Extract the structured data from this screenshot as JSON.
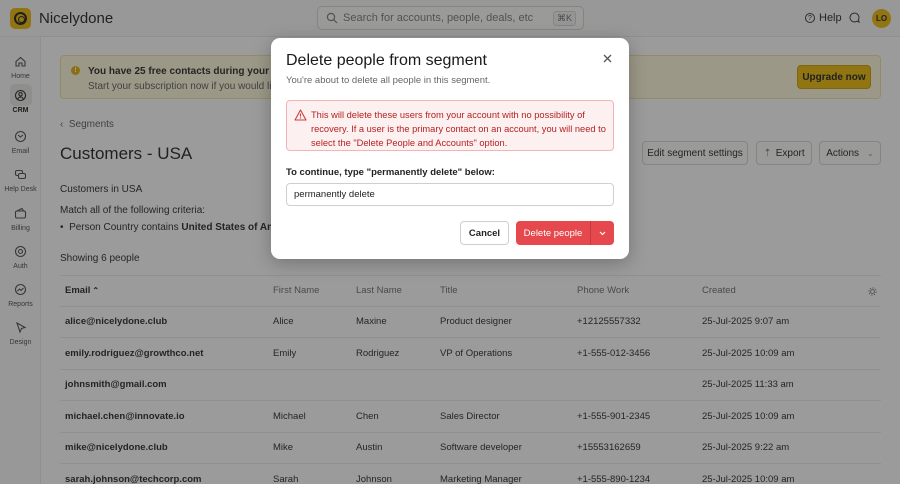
{
  "app": {
    "name": "Nicelydone",
    "user_initials": "LO"
  },
  "search": {
    "placeholder": "Search for accounts, people, deals, etc",
    "shortcut": "⌘K"
  },
  "topbar": {
    "help_label": "Help"
  },
  "sidebar": {
    "items": [
      {
        "label": "Home",
        "icon": "home-icon"
      },
      {
        "label": "CRM",
        "icon": "crm-icon",
        "active": true
      },
      {
        "label": "Email",
        "icon": "email-icon"
      },
      {
        "label": "Help Desk",
        "icon": "help-desk-icon"
      },
      {
        "label": "Billing",
        "icon": "billing-icon"
      },
      {
        "label": "Auth",
        "icon": "auth-icon"
      },
      {
        "label": "Reports",
        "icon": "reports-icon"
      },
      {
        "label": "Design",
        "icon": "design-icon"
      }
    ]
  },
  "banner": {
    "title": "You have 25 free contacts during your free trial",
    "text": "Start your subscription now if you would like to i",
    "upgrade_label": "Upgrade now"
  },
  "breadcrumb": {
    "label": "Segments"
  },
  "page": {
    "title": "Customers - USA",
    "edit_label": "Edit segment settings",
    "export_label": "Export",
    "actions_label": "Actions",
    "segment_desc": "Customers in USA",
    "criteria_heading": "Match all of the following criteria:",
    "criteria": {
      "field": "Person Country",
      "op": "contains",
      "value": "United States of America"
    },
    "showing": "Showing 6 people"
  },
  "table": {
    "columns": [
      "Email",
      "First Name",
      "Last Name",
      "Title",
      "Phone Work",
      "Created"
    ],
    "sort_indicator": "⌃",
    "rows": [
      [
        "alice@nicelydone.club",
        "Alice",
        "Maxine",
        "Product designer",
        "+12125557332",
        "25-Jul-2025 9:07 am"
      ],
      [
        "emily.rodriguez@growthco.net",
        "Emily",
        "Rodriguez",
        "VP of Operations",
        "+1-555-012-3456",
        "25-Jul-2025 10:09 am"
      ],
      [
        "johnsmith@gmail.com",
        "",
        "",
        "",
        "",
        "25-Jul-2025 11:33 am"
      ],
      [
        "michael.chen@innovate.io",
        "Michael",
        "Chen",
        "Sales Director",
        "+1-555-901-2345",
        "25-Jul-2025 10:09 am"
      ],
      [
        "mike@nicelydone.club",
        "Mike",
        "Austin",
        "Software developer",
        "+15553162659",
        "25-Jul-2025 9:22 am"
      ],
      [
        "sarah.johnson@techcorp.com",
        "Sarah",
        "Johnson",
        "Marketing Manager",
        "+1-555-890-1234",
        "25-Jul-2025 10:09 am"
      ]
    ]
  },
  "modal": {
    "title": "Delete people from segment",
    "subtitle": "You're about to delete all people in this segment.",
    "warning": "This will delete these users from your account with no possibility of recovery. If a user is the primary contact on an account, you will need to select the \"Delete People and Accounts\" option.",
    "confirm_label": "To continue, type \"permanently delete\" below:",
    "confirm_value": "permanently delete",
    "cancel_label": "Cancel",
    "delete_label": "Delete people"
  },
  "colors": {
    "accent": "#e6b400",
    "danger": "#e5484d",
    "danger_text": "#b42222"
  }
}
